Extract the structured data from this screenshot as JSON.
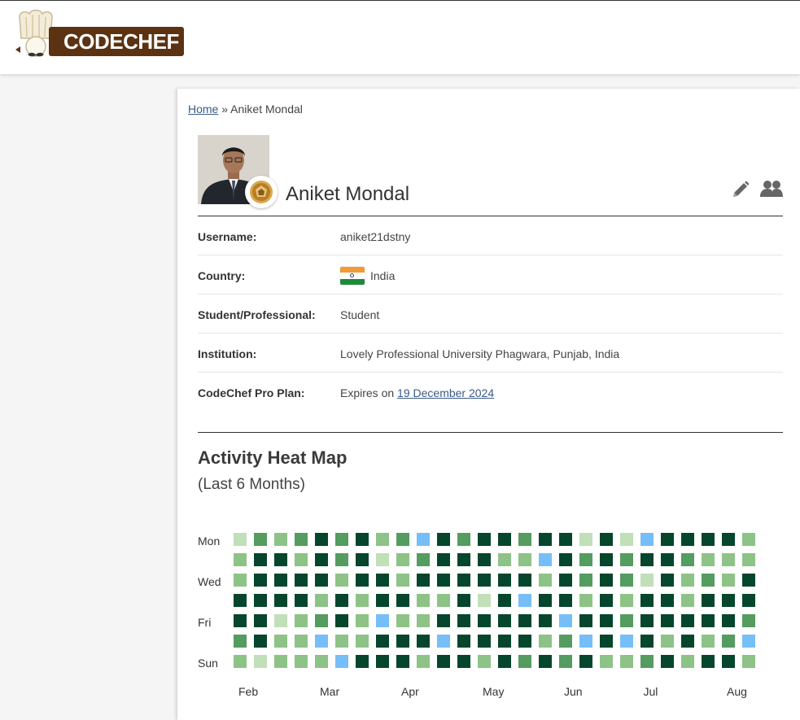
{
  "brand": {
    "logo_text": "CODECHEF"
  },
  "breadcrumb": {
    "home": "Home",
    "separator": "»",
    "current": "Aniket Mondal"
  },
  "profile": {
    "name": "Aniket Mondal",
    "details": [
      {
        "label": "Username:",
        "value": "aniket21dstny"
      },
      {
        "label": "Country:",
        "value": "India",
        "flag": true
      },
      {
        "label": "Student/Professional:",
        "value": "Student"
      },
      {
        "label": "Institution:",
        "value": "Lovely Professional University Phagwara, Punjab, India"
      },
      {
        "label": "CodeChef Pro Plan:",
        "value": "Expires on",
        "link": "19 December 2024"
      }
    ]
  },
  "icons": {
    "edit": "pencil-icon",
    "friends": "users-icon",
    "badge": "star-badge-icon"
  },
  "heatmap": {
    "title": "Activity Heat Map",
    "subtitle": "(Last 6 Months)",
    "day_labels": [
      "Mon",
      "",
      "Wed",
      "",
      "Fri",
      "",
      "Sun"
    ],
    "month_labels": [
      "Feb",
      "Mar",
      "Apr",
      "May",
      "Jun",
      "Jul",
      "Aug"
    ],
    "month_columns": [
      0.2,
      4.2,
      8.2,
      12.2,
      16.2,
      20.1,
      24.2
    ],
    "colors": [
      "#c1dfb8",
      "#8dc386",
      "#549c5f",
      "#05462c",
      "#76bef8"
    ],
    "rows": [
      [
        0,
        2,
        1,
        2,
        3,
        2,
        3,
        1,
        2,
        4,
        3,
        2,
        3,
        3,
        2,
        3,
        3,
        0,
        3,
        0,
        4,
        3,
        3,
        3,
        3,
        1
      ],
      [
        1,
        3,
        3,
        1,
        3,
        2,
        3,
        0,
        1,
        2,
        3,
        3,
        3,
        1,
        1,
        4,
        3,
        2,
        3,
        2,
        3,
        3,
        2,
        1,
        1,
        1
      ],
      [
        1,
        3,
        3,
        3,
        3,
        1,
        3,
        3,
        1,
        3,
        3,
        3,
        3,
        3,
        3,
        1,
        3,
        2,
        3,
        2,
        0,
        3,
        1,
        2,
        1,
        3
      ],
      [
        3,
        3,
        3,
        3,
        1,
        3,
        1,
        3,
        3,
        1,
        1,
        3,
        0,
        3,
        4,
        3,
        3,
        1,
        3,
        1,
        3,
        3,
        1,
        3,
        3,
        3
      ],
      [
        3,
        3,
        0,
        1,
        2,
        3,
        1,
        4,
        1,
        1,
        3,
        3,
        3,
        3,
        3,
        3,
        4,
        3,
        3,
        2,
        3,
        3,
        3,
        3,
        3,
        2
      ],
      [
        2,
        3,
        1,
        1,
        4,
        1,
        1,
        3,
        3,
        3,
        4,
        3,
        3,
        3,
        3,
        1,
        2,
        4,
        3,
        4,
        3,
        1,
        3,
        1,
        2,
        4
      ],
      [
        1,
        0,
        1,
        1,
        1,
        4,
        3,
        3,
        3,
        1,
        3,
        3,
        1,
        3,
        2,
        3,
        2,
        3,
        1,
        1,
        2,
        3,
        1,
        3,
        3,
        1
      ]
    ]
  }
}
